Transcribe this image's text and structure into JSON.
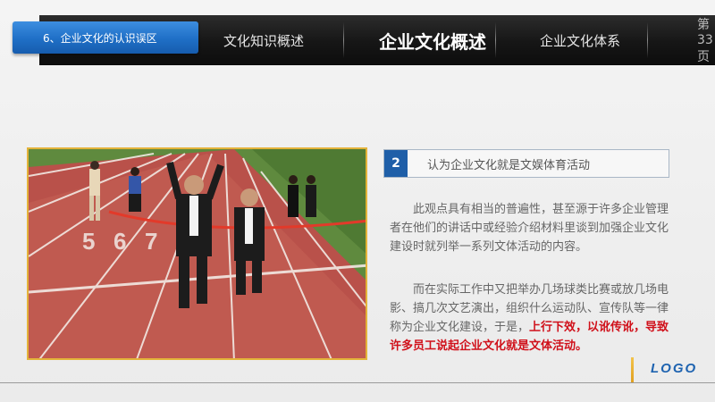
{
  "nav": {
    "active_tab": "6、企业文化的认识误区",
    "items": [
      "文化知识概述",
      "企业文化概述",
      "企业文化体系"
    ],
    "page_number": "第 33 页"
  },
  "photo": {
    "lane_numbers": [
      "5",
      "6",
      "7"
    ]
  },
  "section": {
    "number": "2",
    "title": "认为企业文化就是文娱体育活动"
  },
  "content": {
    "para1": "此观点具有相当的普遍性，甚至源于许多企业管理者在他们的讲话中或经验介绍材料里谈到加强企业文化建设时就列举一系列文体活动的内容。",
    "para2_prefix": "而在实际工作中又把举办几场球类比赛或放几场电影、搞几次文艺演出，组织什么运动队、宣传队等一律称为企业文化建设，于是，",
    "para2_highlight": "上行下效，以讹传讹，导致许多员工说起企业文化就是文体活动。"
  },
  "footer": {
    "logo": "LOGO"
  },
  "colors": {
    "accent_blue": "#1f6fc6",
    "highlight_red": "#d0101a",
    "frame_gold": "#e3b33a"
  }
}
